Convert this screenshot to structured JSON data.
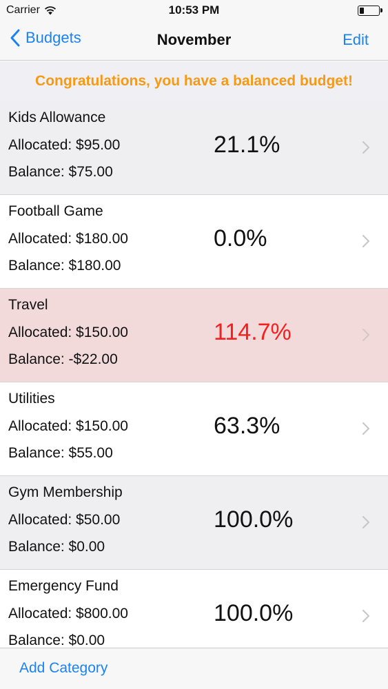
{
  "status_bar": {
    "carrier": "Carrier",
    "time": "10:53 PM"
  },
  "nav": {
    "back_label": "Budgets",
    "title": "November",
    "edit_label": "Edit"
  },
  "banner": {
    "text": "Congratulations, you have a balanced budget!",
    "color": "#f49a17"
  },
  "accent_color": "#1a82f5",
  "over_budget_color": "#f41f1f",
  "categories": [
    {
      "name": "Kids Allowance",
      "allocated": "Allocated: $95.00",
      "balance": "Balance: $75.00",
      "percent": "21.1%"
    },
    {
      "name": "Football Game",
      "allocated": "Allocated: $180.00",
      "balance": "Balance: $180.00",
      "percent": "0.0%"
    },
    {
      "name": "Travel",
      "allocated": "Allocated: $150.00",
      "balance": "Balance: -$22.00",
      "percent": "114.7%"
    },
    {
      "name": "Utilities",
      "allocated": "Allocated: $150.00",
      "balance": "Balance: $55.00",
      "percent": "63.3%"
    },
    {
      "name": "Gym Membership",
      "allocated": "Allocated: $50.00",
      "balance": "Balance: $0.00",
      "percent": "100.0%"
    },
    {
      "name": "Emergency Fund",
      "allocated": "Allocated: $800.00",
      "balance": "Balance: $0.00",
      "percent": "100.0%"
    }
  ],
  "toolbar": {
    "add_label": "Add Category"
  }
}
